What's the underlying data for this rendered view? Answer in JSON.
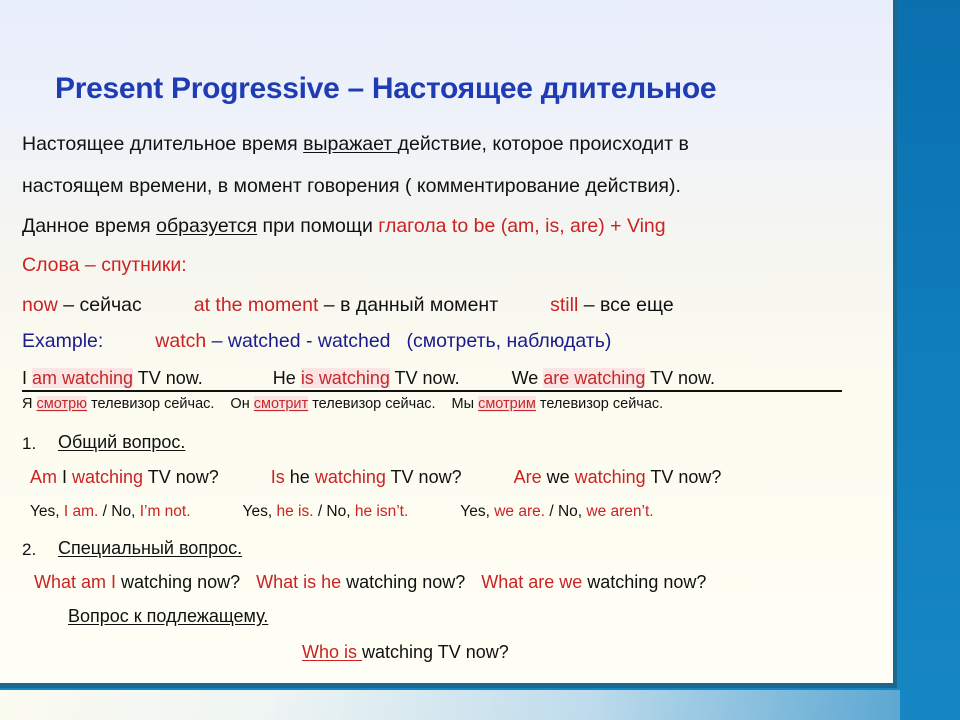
{
  "slide": {
    "title": "Present Progressive – Настоящее длительное",
    "colors": {
      "title_blue": "#1f3cb4",
      "accent_red": "#cc2222",
      "navy": "#1b1b8e",
      "body_black": "#111111",
      "frame_blue": "#0f7cbb",
      "slide_border": "#1a6791",
      "highlight_pink": "#fbe4e4"
    },
    "intro": {
      "line1_a": "Настоящее длительное время ",
      "line1_b": "выражает ",
      "line1_c": " действие, которое происходит в",
      "line2": "настоящем времени, в момент говорения ( комментирование действия).",
      "line3_a": "Данное время ",
      "line3_b": "образуется",
      "line3_c": " при помощи ",
      "line3_d": "глагола to be (am, is, are) + Ving",
      "line4": "Слова – спутники:"
    },
    "markers": {
      "now_en": "now",
      "now_dash": " – ",
      "now_ru": "сейчас",
      "moment_en": "at the moment",
      "moment_dash": " – ",
      "moment_ru": "в данный момент",
      "still_en": "still",
      "still_dash": " – ",
      "still_ru": "все еще"
    },
    "example": {
      "label": "Example:",
      "verb_red": "watch",
      "forms_blue": " – watched - watched",
      "translation": "(смотреть, наблюдать)"
    },
    "affirmative": {
      "s1_pre": "I ",
      "s1_verb": "am watching",
      "s1_post": " TV now.",
      "s2_pre": "He ",
      "s2_verb": "is watching",
      "s2_post": " TV now.",
      "s3_pre": "We ",
      "s3_verb": "are watching",
      "s3_post": " TV now."
    },
    "affirmative_ru": {
      "r1_pre": "Я ",
      "r1_verb": "смотрю",
      "r1_post": " телевизор сейчас.",
      "r2_pre": "Он ",
      "r2_verb": "смотрит",
      "r2_post": " телевизор сейчас.",
      "r3_pre": "Мы ",
      "r3_verb": "смотрим",
      "r3_post": " телевизор сейчас."
    },
    "section1": {
      "number": "1.",
      "heading": "Общий вопрос.",
      "q1_a": "Am",
      "q1_b": " I ",
      "q1_c": "watching",
      "q1_d": " TV now?",
      "q2_a": "Is",
      "q2_b": " he ",
      "q2_c": "watching",
      "q2_d": " TV now?",
      "q3_a": "Are",
      "q3_b": " we ",
      "q3_c": "watching",
      "q3_d": " TV now?",
      "a1_yes": "Yes, ",
      "a1_yes_r": "I am.",
      "a1_sep": " / No, ",
      "a1_no_r": "I’m not.",
      "a2_yes": "Yes, ",
      "a2_yes_r": "he is.",
      "a2_sep": " / No, ",
      "a2_no_r": "he isn’t.",
      "a3_yes": "Yes, ",
      "a3_yes_r": "we are.",
      "a3_sep": " / No, ",
      "a3_no_r": "we aren’t."
    },
    "section2": {
      "number": "2.",
      "heading": "Специальный вопрос.",
      "q1_red": "What am I",
      "q1_black": " watching now?",
      "q2_red": "What is he",
      "q2_black": " watching now?",
      "q3_red": "What are we",
      "q3_black": " watching now?"
    },
    "section3": {
      "heading": "Вопрос к подлежащему.",
      "q_red": "Who is ",
      "q_black": "watching TV now?"
    }
  }
}
